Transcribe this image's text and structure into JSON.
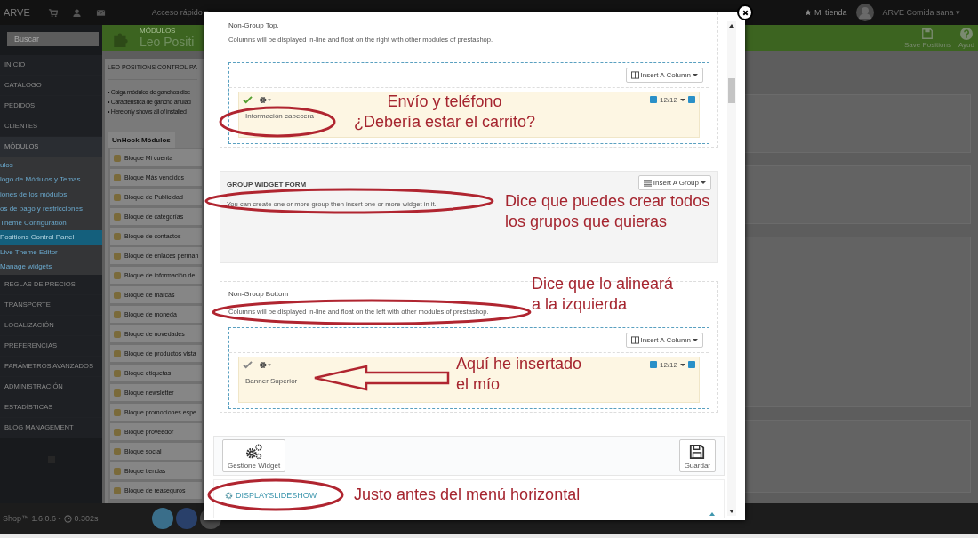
{
  "topbar": {
    "brand": "ARVE",
    "quick_access": "Acceso rápido ▾",
    "shop_link": "Mi tienda",
    "user": "ARVE Comida sana ▾"
  },
  "sidebar": {
    "search": {
      "placeholder": "Buscar"
    },
    "items": [
      {
        "label": "INICIO",
        "selected": false
      },
      {
        "label": "CATÁLOGO",
        "selected": false
      },
      {
        "label": "PEDIDOS",
        "selected": false
      },
      {
        "label": "CLIENTES",
        "selected": false
      },
      {
        "label": "MÓDULOS",
        "selected": true,
        "children": [
          {
            "label": "ulos",
            "selected": false
          },
          {
            "label": "logo de Módulos y Temas",
            "selected": false
          },
          {
            "label": "iones de los módulos",
            "selected": false
          },
          {
            "label": "os de pago y restricciones",
            "selected": false
          },
          {
            "label": "Theme Configuration",
            "selected": false
          },
          {
            "label": "Positions Control Panel",
            "selected": true
          },
          {
            "label": "Live Theme Editor",
            "selected": false
          },
          {
            "label": "Manage widgets",
            "selected": false
          }
        ]
      },
      {
        "label": "REGLAS DE PRECIOS",
        "selected": false
      },
      {
        "label": "TRANSPORTE",
        "selected": false
      },
      {
        "label": "LOCALIZACIÓN",
        "selected": false
      },
      {
        "label": "PREFERENCIAS",
        "selected": false
      },
      {
        "label": "PARÁMETROS AVANZADOS",
        "selected": false
      },
      {
        "label": "ADMINISTRACIÓN",
        "selected": false
      },
      {
        "label": "ESTADÍSTICAS",
        "selected": false
      },
      {
        "label": "BLOG MANAGEMENT",
        "selected": false
      }
    ]
  },
  "header": {
    "breadcrumb": "MÓDULOS",
    "title": "Leo Positi",
    "actions": [
      {
        "kind": "save",
        "label": "Save Positions"
      },
      {
        "kind": "help",
        "label": "Ayud"
      }
    ]
  },
  "panel": {
    "title": "LEO POSITIONS CONTROL PA",
    "notes": [
      "• Caiga módulos de ganchos dise",
      "• Característica de gancho anulad",
      "• Here only shows all of installed"
    ],
    "tab": "UnHook Módulos",
    "modules": [
      "Bloque Mi cuenta",
      "Bloque Más vendidos",
      "Bloque de Publicidad",
      "Bloque de categorías",
      "Bloque de contactos",
      "Bloque de enlaces perman",
      "Bloque de información de",
      "Bloque de marcas",
      "Bloque de moneda",
      "Bloque de novedades",
      "Bloque de productos vista",
      "Bloque etiquetas",
      "Bloque newsletter",
      "Bloque promociones espe",
      "Bloque proveedor",
      "Bloque social",
      "Bloque tiendas",
      "Bloque de reaseguros"
    ]
  },
  "footer": {
    "version": "Shop™ 1.6.0.6 -",
    "load_time": "0.302s"
  },
  "modal": {
    "sections": [
      {
        "kind": "columns",
        "title": "Non-Group Top.",
        "description": "Columns will be displayed in-line and float on the right with other modules of prestashop.",
        "button": "Insert A Column",
        "column": {
          "active": true,
          "size": "12/12",
          "label": "Información cabecera"
        }
      },
      {
        "kind": "group",
        "title": "GROUP WIDGET FORM",
        "description": "You can create one or more group then insert one or more widget in it.",
        "button": "Insert A Group"
      },
      {
        "kind": "columns",
        "title": "Non-Group Bottom",
        "description": "Columns will be displayed in-line and float on the left with other modules of prestashop.",
        "button": "Insert A Column",
        "column": {
          "active": false,
          "size": "12/12",
          "label": "Banner Superior"
        }
      }
    ],
    "actions": [
      {
        "kind": "widgets",
        "label": "Gestione Widget"
      },
      {
        "kind": "save",
        "label": "Guardar"
      }
    ],
    "hook": "DISPLAYSLIDESHOW",
    "annotations": [
      {
        "kind": "note",
        "lines": [
          "Envío y teléfono",
          "¿Debería estar el carrito?"
        ]
      },
      {
        "kind": "note",
        "lines": [
          "Dice que puedes crear todos",
          "los grupos que quieras"
        ]
      },
      {
        "kind": "note",
        "lines": [
          "Dice que lo alineará",
          "a la izquierda"
        ]
      },
      {
        "kind": "note",
        "lines": [
          "Aquí he insertado",
          "el mío"
        ]
      },
      {
        "kind": "note",
        "lines": [
          "Justo antes del menú horizontal"
        ]
      },
      {
        "kind": "ellipse"
      },
      {
        "kind": "ellipse"
      },
      {
        "kind": "ellipse"
      },
      {
        "kind": "ellipse"
      },
      {
        "kind": "arrow"
      }
    ]
  }
}
